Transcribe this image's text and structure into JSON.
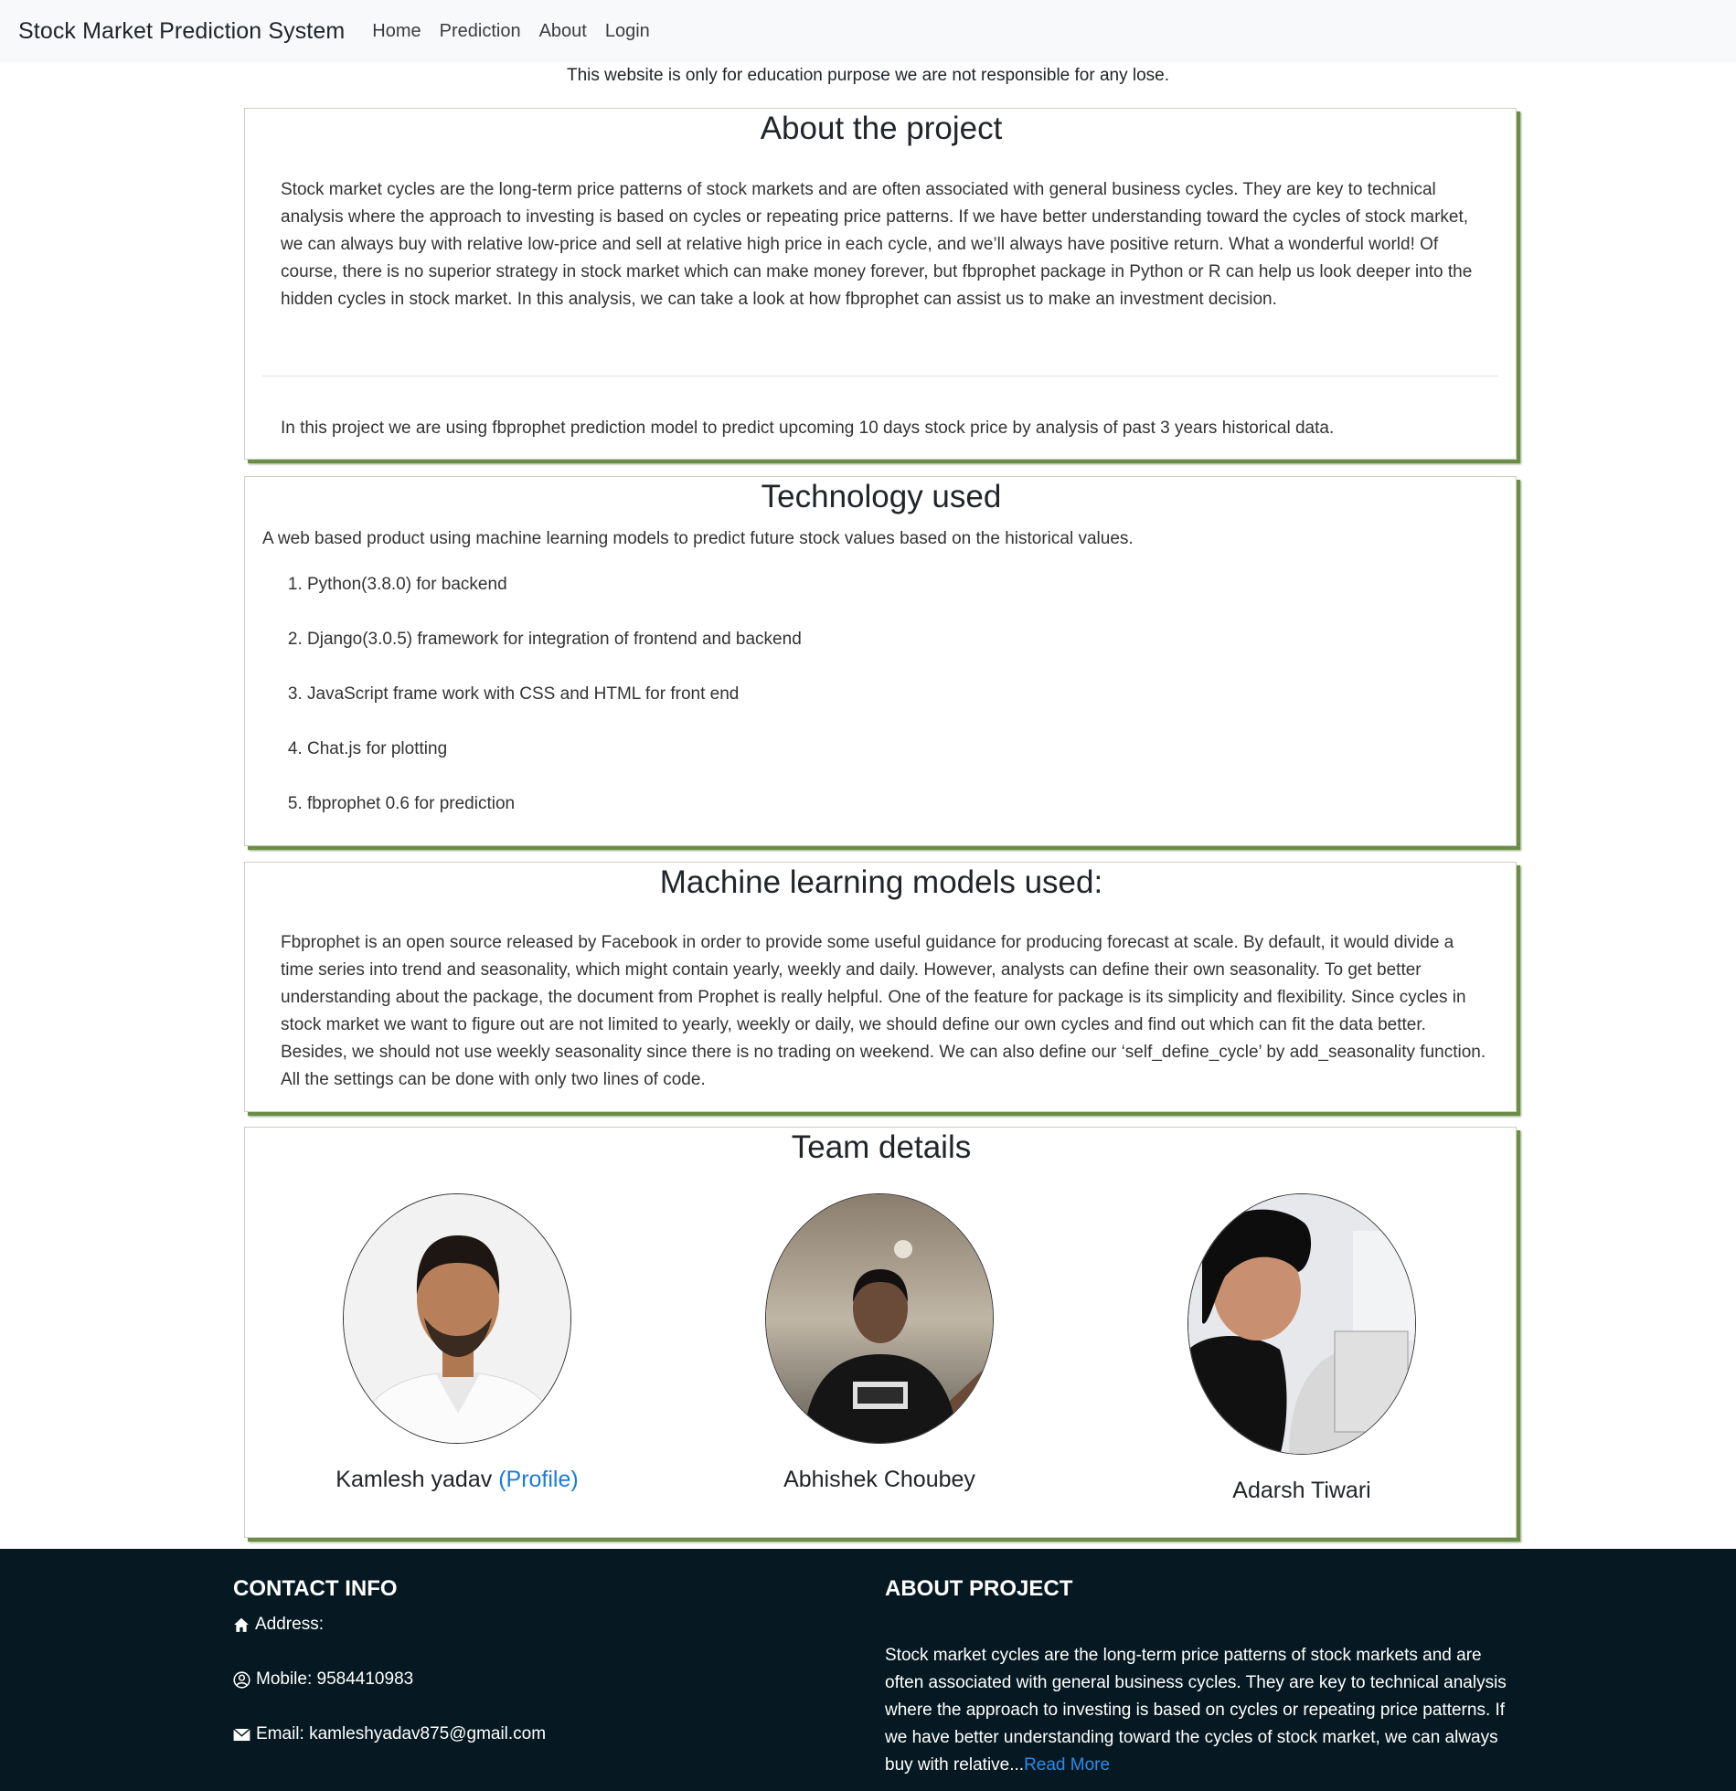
{
  "navbar": {
    "brand": "Stock Market Prediction System",
    "links": [
      "Home",
      "Prediction",
      "About",
      "Login"
    ]
  },
  "disclaimer": "This website is only for education purpose we are not responsible for any lose.",
  "about": {
    "title": "About the project",
    "paragraph": "Stock market cycles are the long-term price patterns of stock markets and are often associated with general business cycles. They are key to technical analysis where the approach to investing is based on cycles or repeating price patterns. If we have better understanding toward the cycles of stock market, we can always buy with relative low-price and sell at relative high price in each cycle, and we’ll always have positive return. What a wonderful world! Of course, there is no superior strategy in stock market which can make money forever, but fbprophet package in Python or R can help us look deeper into the hidden cycles in stock market. In this analysis, we can take a look at how fbprophet can assist us to make an investment decision.",
    "summary": "In this project we are using fbprophet prediction model to predict upcoming 10 days stock price by analysis of past 3 years historical data."
  },
  "technology": {
    "title": "Technology used",
    "intro": "A web based product using machine learning models to predict future stock values based on the historical values.",
    "items": [
      "Python(3.8.0) for backend",
      "Django(3.0.5) framework for integration of frontend and backend",
      "JavaScript frame work with CSS and HTML for front end",
      "Chat.js for plotting",
      "fbprophet 0.6 for prediction"
    ]
  },
  "ml": {
    "title": "Machine learning models used:",
    "paragraph": "Fbprophet is an open source released by Facebook in order to provide some useful guidance for producing forecast at scale. By default, it would divide a time series into trend and seasonality, which might contain yearly, weekly and daily. However, analysts can define their own seasonality. To get better understanding about the package, the document from Prophet is really helpful. One of the feature for package is its simplicity and flexibility. Since cycles in stock market we want to figure out are not limited to yearly, weekly or daily, we should define our own cycles and find out which can fit the data better. Besides, we should not use weekly seasonality since there is no trading on weekend. We can also define our ‘self_define_cycle’ by add_seasonality function. All the settings can be done with only two lines of code."
  },
  "team": {
    "title": "Team details",
    "members": [
      {
        "name": "Kamlesh yadav",
        "link": "(Profile)"
      },
      {
        "name": "Abhishek Choubey"
      },
      {
        "name": "Adarsh Tiwari"
      }
    ]
  },
  "footer": {
    "contact_title": "CONTACT INFO",
    "address_label": "Address:",
    "mobile_label": "Mobile: 9584410983",
    "email_label": "Email: kamleshyadav875@gmail.com",
    "about_title": "ABOUT PROJECT",
    "about_text": "Stock market cycles are the long-term price patterns of stock markets and are often associated with general business cycles. They are key to technical analysis where the approach to investing is based on cycles or repeating price patterns. If we have better understanding toward the cycles of stock market, we can always buy with relative...",
    "read_more": "Read More"
  },
  "icons": {
    "address": "home-icon",
    "mobile": "user-circle-icon",
    "email": "envelope-icon"
  }
}
